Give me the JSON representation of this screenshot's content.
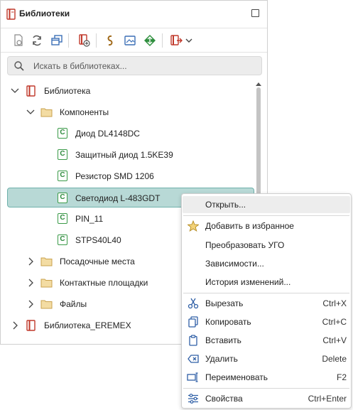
{
  "panel": {
    "title": "Библиотеки"
  },
  "toolbar": {
    "buttons": [
      "new-document-icon",
      "refresh-icon",
      "windows-icon",
      "library-add-icon",
      "link-icon",
      "image-icon",
      "diamond-arrows-icon",
      "export-icon"
    ]
  },
  "search": {
    "placeholder": "Искать в библиотеках..."
  },
  "tree": {
    "items": [
      {
        "label": "Библиотека",
        "level": 0,
        "type": "library",
        "expanded": true
      },
      {
        "label": "Компоненты",
        "level": 1,
        "type": "folder",
        "expanded": true
      },
      {
        "label": "Диод DL4148DC",
        "level": 2,
        "type": "component"
      },
      {
        "label": "Защитный диод 1.5KE39",
        "level": 2,
        "type": "component"
      },
      {
        "label": "Резистор SMD 1206",
        "level": 2,
        "type": "component"
      },
      {
        "label": "Светодиод L-483GDT",
        "level": 2,
        "type": "component",
        "selected": true
      },
      {
        "label": "PIN_11",
        "level": 2,
        "type": "component"
      },
      {
        "label": "STPS40L40",
        "level": 2,
        "type": "component"
      },
      {
        "label": "Посадочные места",
        "level": 1,
        "type": "folder",
        "expanded": false
      },
      {
        "label": "Контактные площадки",
        "level": 1,
        "type": "folder",
        "expanded": false
      },
      {
        "label": "Файлы",
        "level": 1,
        "type": "folder",
        "expanded": false
      },
      {
        "label": "Библиотека_EREMEX",
        "level": 0,
        "type": "library",
        "expanded": false
      }
    ]
  },
  "context_menu": {
    "items": [
      {
        "label": "Открыть...",
        "shortcut": "",
        "icon": "",
        "hover": true
      },
      {
        "label": "Добавить в избранное",
        "shortcut": "",
        "icon": "star-icon"
      },
      {
        "label": "Преобразовать УГО",
        "shortcut": "",
        "icon": ""
      },
      {
        "label": "Зависимости...",
        "shortcut": "",
        "icon": ""
      },
      {
        "label": "История изменений...",
        "shortcut": "",
        "icon": ""
      },
      {
        "label": "Вырезать",
        "shortcut": "Ctrl+X",
        "icon": "scissors-icon"
      },
      {
        "label": "Копировать",
        "shortcut": "Ctrl+C",
        "icon": "copy-icon"
      },
      {
        "label": "Вставить",
        "shortcut": "Ctrl+V",
        "icon": "clipboard-icon"
      },
      {
        "label": "Удалить",
        "shortcut": "Delete",
        "icon": "delete-icon"
      },
      {
        "label": "Переименовать",
        "shortcut": "F2",
        "icon": "rename-icon"
      },
      {
        "label": "Свойства",
        "shortcut": "Ctrl+Enter",
        "icon": "properties-icon"
      }
    ]
  },
  "colors": {
    "selection_bg": "#b8d9d6",
    "selection_border": "#6fb1ab",
    "component_icon": "#3a9a48",
    "library_icon": "#c0392b",
    "folder": "#e8c77a"
  }
}
